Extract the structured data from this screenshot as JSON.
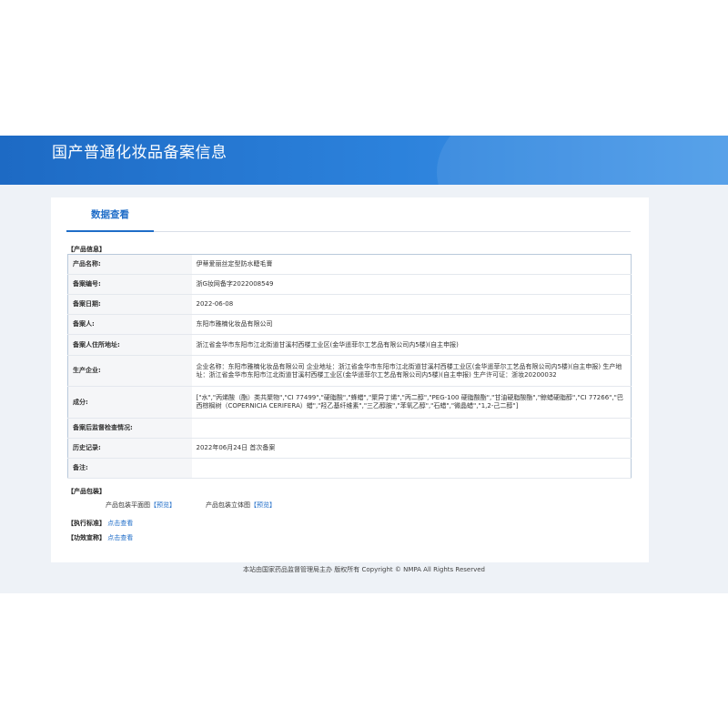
{
  "header": {
    "title": "国产普通化妆品备案信息"
  },
  "tabs": {
    "active": "数据查看"
  },
  "product_info": {
    "section_label": "【产品信息】",
    "rows": [
      {
        "key": "产品名称:",
        "value": "伊蒂爱丽丝定型防水睫毛膏"
      },
      {
        "key": "备案编号:",
        "value": "浙G妆网备字2022008549"
      },
      {
        "key": "备案日期:",
        "value": "2022-06-08"
      },
      {
        "key": "备案人:",
        "value": "东阳市雅楠化妆品有限公司"
      },
      {
        "key": "备案人住所地址:",
        "value": "浙江省金华市东阳市江北街道甘溪村西楼工业区(金华遥菲尔工艺品有限公司内5楼)(自主申报)"
      },
      {
        "key": "生产企业:",
        "value": "企业名称：东阳市雅楠化妆品有限公司 企业地址：浙江省金华市东阳市江北街道甘溪村西楼工业区(金华遥菲尔工艺品有限公司内5楼)(自主申报) 生产地址：浙江省金华市东阳市江北街道甘溪村西楼工业区(金华遥菲尔工艺品有限公司内5楼)(自主申报) 生产许可证：浙妆20200032"
      },
      {
        "key": "成分:",
        "value": "[\"水\",\"丙烯酸（酯）类共聚物\",\"CI 77499\",\"硬脂酸\",\"蜂蜡\",\"聚异丁烯\",\"丙二醇\",\"PEG-100 硬脂酸酯\",\"甘油硬脂酸酯\",\"鲸蜡硬脂醇\",\"CI 77266\",\"巴西棕榈树（COPERNICIA CERIFERA）蜡\",\"羟乙基纤维素\",\"三乙醇胺\",\"苯氧乙醇\",\"石蜡\",\"微晶蜡\",\"1,2-己二醇\"]"
      },
      {
        "key": "备案后监督检查情况:",
        "value": ""
      },
      {
        "key": "历史记录:",
        "value": "2022年06月24日 首次备案"
      },
      {
        "key": "备注:",
        "value": ""
      }
    ]
  },
  "packaging": {
    "section_label": "【产品包装】",
    "flat_label": "产品包装平面图",
    "flat_link": "【预览】",
    "solid_label": "产品包装立体图",
    "solid_link": "【预览】"
  },
  "standard": {
    "label": "【执行标准】",
    "link": "点击查看"
  },
  "efficacy": {
    "label": "【功效宣称】",
    "link": "点击查看"
  },
  "footer": {
    "text": "本站由国家药品监督管理局主办 版权所有 Copyright © NMPA All Rights Reserved"
  },
  "colors": {
    "accent": "#1f6dc8",
    "banner": "#2c82dc",
    "page_bg": "#eef2f7"
  }
}
